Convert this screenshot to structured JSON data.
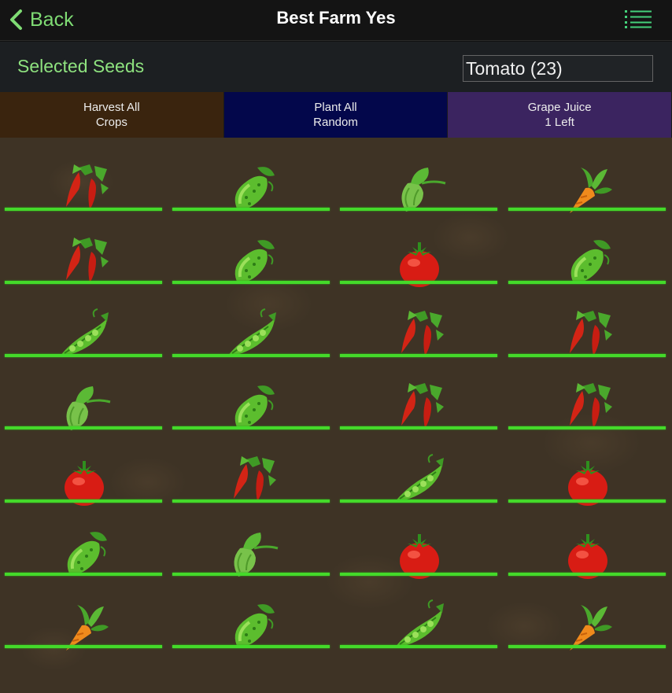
{
  "topbar": {
    "back_label": "Back",
    "title": "Best Farm Yes",
    "back_icon": "chevron-left-icon",
    "menu_icon": "menu-list-icon",
    "accent_color": "#7fdc74"
  },
  "seeds": {
    "label": "Selected Seeds",
    "selected": "Tomato (23)"
  },
  "actions": [
    {
      "label": "Harvest All\nCrops",
      "color": "#3a240e"
    },
    {
      "label": "Plant All\nRandom",
      "color": "#03074b"
    },
    {
      "label": "Grape Juice\n1 Left",
      "color": "#3b2460"
    }
  ],
  "field": {
    "columns": 4,
    "progress_color": "#44d92a",
    "plots": [
      {
        "crop": "chili",
        "progress": 1.0
      },
      {
        "crop": "cucumber",
        "progress": 1.0
      },
      {
        "crop": "hops",
        "progress": 1.0
      },
      {
        "crop": "carrot",
        "progress": 1.0
      },
      {
        "crop": "chili",
        "progress": 1.0
      },
      {
        "crop": "cucumber",
        "progress": 1.0
      },
      {
        "crop": "tomato",
        "progress": 1.0
      },
      {
        "crop": "cucumber",
        "progress": 1.0
      },
      {
        "crop": "pea",
        "progress": 1.0
      },
      {
        "crop": "pea",
        "progress": 1.0
      },
      {
        "crop": "chili",
        "progress": 1.0
      },
      {
        "crop": "chili",
        "progress": 1.0
      },
      {
        "crop": "hops",
        "progress": 1.0
      },
      {
        "crop": "cucumber",
        "progress": 1.0
      },
      {
        "crop": "chili",
        "progress": 1.0
      },
      {
        "crop": "chili",
        "progress": 1.0
      },
      {
        "crop": "tomato",
        "progress": 1.0
      },
      {
        "crop": "chili",
        "progress": 1.0
      },
      {
        "crop": "pea",
        "progress": 1.0
      },
      {
        "crop": "tomato",
        "progress": 1.0
      },
      {
        "crop": "cucumber",
        "progress": 1.0
      },
      {
        "crop": "hops",
        "progress": 1.0
      },
      {
        "crop": "tomato",
        "progress": 1.0
      },
      {
        "crop": "tomato",
        "progress": 1.0
      },
      {
        "crop": "carrot",
        "progress": 1.0
      },
      {
        "crop": "cucumber",
        "progress": 1.0
      },
      {
        "crop": "pea",
        "progress": 1.0
      },
      {
        "crop": "carrot",
        "progress": 1.0
      }
    ]
  }
}
